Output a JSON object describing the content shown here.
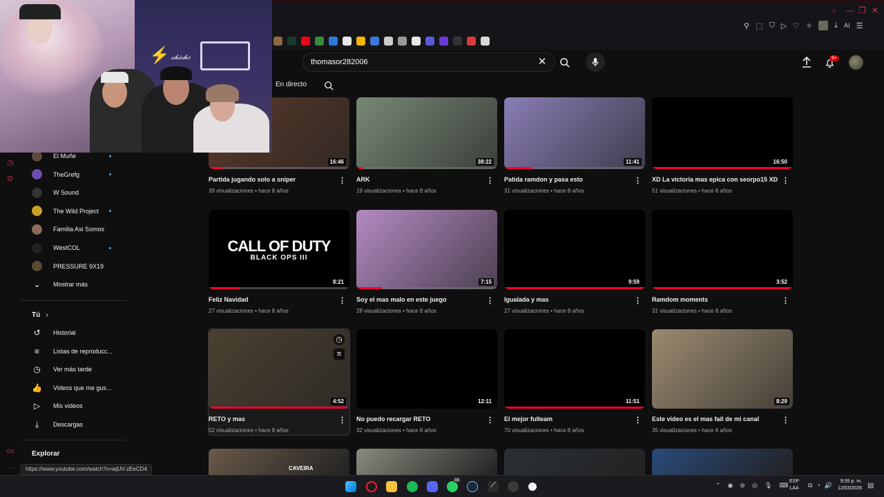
{
  "browser": {
    "extensions": [
      "ext-a",
      "ext-b",
      "netflix",
      "ext-c",
      "ext-d",
      "ext-e",
      "ext-f",
      "ext-g",
      "ext-h",
      "ext-i",
      "ext-j",
      "ext-k",
      "ext-l",
      "ext-m",
      "ext-n",
      "ext-o"
    ],
    "ai_label": "AI"
  },
  "header": {
    "search_value": "thomasor282006",
    "notif_badge": "9+"
  },
  "tabs": {
    "live_label": "En directo"
  },
  "sidebar": {
    "subscriptions": [
      {
        "label": "El Muñe",
        "dot": true,
        "color": "#5a4a3a"
      },
      {
        "label": "TheGrefg",
        "dot": true,
        "color": "#6a4fb0"
      },
      {
        "label": "W Sound",
        "dot": false,
        "color": "#333"
      },
      {
        "label": "The Wild Project",
        "dot": true,
        "color": "#c9a227"
      },
      {
        "label": "Familia Asi Somos",
        "dot": false,
        "color": "#8a6a5a"
      },
      {
        "label": "WestCOL",
        "dot": true,
        "color": "#222"
      },
      {
        "label": "PRESSURE 9X19",
        "dot": false,
        "color": "#5a4a30"
      }
    ],
    "show_more": "Mostrar más",
    "you_heading": "Tú",
    "you_items": [
      {
        "label": "Historial",
        "icon": "history-icon",
        "glyph": "↺"
      },
      {
        "label": "Listas de reproducc...",
        "icon": "playlist-icon",
        "glyph": "≡"
      },
      {
        "label": "Ver más tarde",
        "icon": "clock-icon",
        "glyph": "◷"
      },
      {
        "label": "Videos que me gus...",
        "icon": "thumbs-up-icon",
        "glyph": "👍"
      },
      {
        "label": "Mis videos",
        "icon": "my-videos-icon",
        "glyph": "▷"
      },
      {
        "label": "Descargas",
        "icon": "download-icon",
        "glyph": "⤓"
      }
    ],
    "explore_heading": "Explorar"
  },
  "videos": [
    {
      "title": "Partida jugando solo a sniper",
      "meta": "39 visualizaciones • hace 8 años",
      "duration": "16:46",
      "thumb": "#5b3a2a",
      "progress": 0.1
    },
    {
      "title": "ARK",
      "meta": "19 visualizaciones • hace 8 años",
      "duration": "38:22",
      "thumb": "#7a8a78",
      "progress": 0.05
    },
    {
      "title": "Patida ramdon y pasa esto",
      "meta": "31 visualizaciones • hace 8 años",
      "duration": "11:41",
      "thumb": "#8c7fb8",
      "progress": 0.2
    },
    {
      "title": "XD La victoria mas epica con seorpo15 XD",
      "meta": "51 visualizaciones • hace 8 años",
      "duration": "16:50",
      "thumb": "#000000",
      "progress": 1.0
    },
    {
      "title": "Feliz Navidad",
      "meta": "27 visualizaciones • hace 8 años",
      "duration": "8:21",
      "thumb": "#000000",
      "progress": 0.22,
      "cod": true,
      "cod_title": "CALL OF DUTY",
      "cod_sub": "BLACK OPS III"
    },
    {
      "title": "Soy el mas malo en este juego",
      "meta": "28 visualizaciones • hace 8 años",
      "duration": "7:15",
      "thumb": "#b48ac2",
      "progress": 0.18
    },
    {
      "title": "Igualada y mas",
      "meta": "27 visualizaciones • hace 8 años",
      "duration": "9:59",
      "thumb": "#000000",
      "progress": 1.0
    },
    {
      "title": "Ramdom moments",
      "meta": "31 visualizaciones • hace 8 años",
      "duration": "3:52",
      "thumb": "#000000",
      "progress": 1.0
    },
    {
      "title": "RETO y mas",
      "meta": "52 visualizaciones • hace 8 años",
      "duration": "4:52",
      "thumb": "#4a4030",
      "progress": 1.0,
      "hover": true
    },
    {
      "title": "No puedo recargar RETO",
      "meta": "32 visualizaciones • hace 8 años",
      "duration": "12:11",
      "thumb": "#000000",
      "progress": 0
    },
    {
      "title": "El mejor fulteam",
      "meta": "70 visualizaciones • hace 8 años",
      "duration": "11:51",
      "thumb": "#000000",
      "progress": 1.0
    },
    {
      "title": "Este video es el mas fail de mi canal",
      "meta": "35 visualizaciones • hace 8 años",
      "duration": "8:29",
      "thumb": "#9b8a70",
      "progress": 0
    }
  ],
  "partial_row": [
    {
      "thumb": "#6a5a4a",
      "label": "CAVEIRA"
    },
    {
      "thumb": "#8a8a80",
      "label": ""
    },
    {
      "thumb": "#2a3036",
      "label": ""
    },
    {
      "thumb": "#2a4a7a",
      "label": ""
    }
  ],
  "status_url": "https://www.youtube.com/watch?v=wjUV-zEeCD4",
  "taskbar": {
    "lang": "ESP",
    "lang_sub": "LAA",
    "time": "9:55 p. m.",
    "date": "12/03/2026",
    "whatsapp_badge": "33"
  }
}
